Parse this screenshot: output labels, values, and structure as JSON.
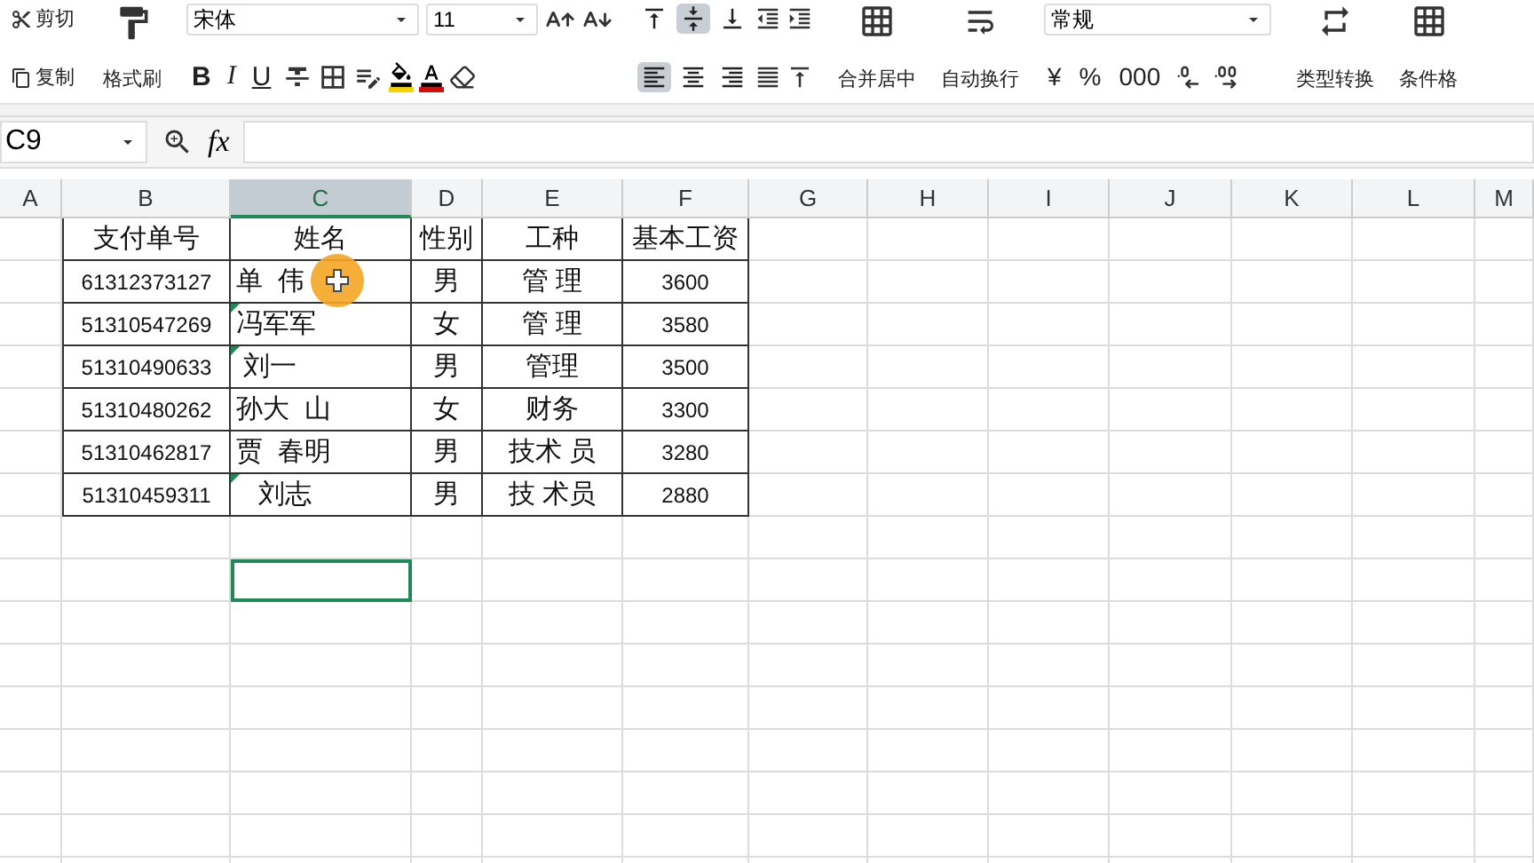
{
  "toolbar": {
    "clipboard": [
      {
        "kind": "cut",
        "label": "剪切"
      },
      {
        "kind": "copy",
        "label": "复制"
      }
    ],
    "format_painter": {
      "label": "格式刷"
    },
    "font": {
      "value": "宋体"
    },
    "font_size": {
      "value": "11"
    },
    "style_buttons": [
      {
        "label": "B",
        "kind": "bold"
      },
      {
        "label": "I",
        "kind": "italic"
      },
      {
        "label": "U",
        "kind": "underline"
      }
    ],
    "vertical_align": [
      {
        "kind": "top",
        "selected": false
      },
      {
        "kind": "middle",
        "selected": true
      },
      {
        "kind": "bottom",
        "selected": false
      }
    ],
    "horizontal_align": [
      {
        "kind": "left",
        "selected": true
      },
      {
        "kind": "center",
        "selected": false
      },
      {
        "kind": "right",
        "selected": false
      }
    ],
    "merge": {
      "label": "合并居中"
    },
    "wrap": {
      "label": "自动换行"
    },
    "number_format": {
      "value": "常规"
    },
    "number_buttons": [
      {
        "label": "¥"
      },
      {
        "label": "%"
      },
      {
        "label": "000"
      }
    ],
    "convert": {
      "label": "类型转换"
    },
    "conditional": {
      "label": "条件格"
    }
  },
  "formula_bar": {
    "name_box": "C9",
    "fx": "fx"
  },
  "columns": [
    {
      "label": "A",
      "selected": false
    },
    {
      "label": "B",
      "selected": false
    },
    {
      "label": "C",
      "selected": true
    },
    {
      "label": "D",
      "selected": false
    },
    {
      "label": "E",
      "selected": false
    },
    {
      "label": "F",
      "selected": false
    },
    {
      "label": "G",
      "selected": false
    },
    {
      "label": "H",
      "selected": false
    },
    {
      "label": "I",
      "selected": false
    },
    {
      "label": "J",
      "selected": false
    },
    {
      "label": "K",
      "selected": false
    },
    {
      "label": "L",
      "selected": false
    },
    {
      "label": "M",
      "selected": false
    }
  ],
  "table": {
    "header": [
      "支付单号",
      "姓名",
      "性别",
      "工种",
      "基本工资"
    ],
    "rows": [
      {
        "id": "61312373127",
        "name": "单  伟",
        "flag": false,
        "gender": "男",
        "job": "管 理",
        "salary": "3600"
      },
      {
        "id": "51310547269",
        "name": "冯军军",
        "flag": true,
        "gender": "女",
        "job": "管 理",
        "salary": "3580"
      },
      {
        "id": "51310490633",
        "name": " 刘一",
        "flag": true,
        "gender": "男",
        "job": "管理",
        "salary": "3500"
      },
      {
        "id": "51310480262",
        "name": "孙大  山",
        "flag": false,
        "gender": "女",
        "job": "财务",
        "salary": "3300"
      },
      {
        "id": "51310462817",
        "name": "贾  春明",
        "flag": false,
        "gender": "男",
        "job": "技术 员",
        "salary": "3280"
      },
      {
        "id": "51310459311",
        "name": "   刘志",
        "flag": true,
        "gender": "男",
        "job": "技 术员",
        "salary": "2880"
      }
    ]
  },
  "blank_rows": [
    {
      "selected": false
    },
    {
      "selected": true
    },
    {
      "selected": false
    },
    {
      "selected": false
    },
    {
      "selected": false
    },
    {
      "selected": false
    },
    {
      "selected": false
    },
    {
      "selected": false
    },
    {
      "selected": false
    }
  ]
}
